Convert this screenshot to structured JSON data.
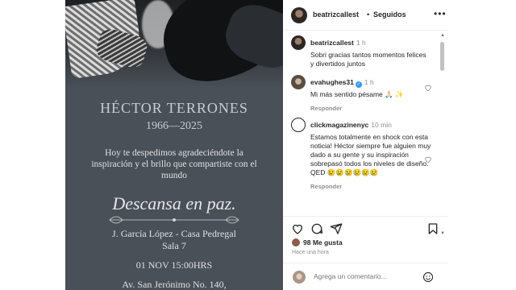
{
  "post_image": {
    "name": "HÉCTOR TERRONES",
    "years": "1966—2025",
    "message": "Hoy te despedimos agradeciéndote la inspiración y el brillo que compartiste con el mundo",
    "rest": "Descansa en paz.",
    "place": "J. García López - Casa Pedregal Sala 7",
    "datetime": "01 NOV 15:00HRS",
    "address": "Av. San Jerónimo No. 140,"
  },
  "header": {
    "username": "beatrizcallest",
    "separator": "•",
    "follow_status": "Seguidos",
    "more_icon": "more-horizontal-icon"
  },
  "comments": [
    {
      "user": "beatrizcallest",
      "time": "1 h",
      "text": "Sobri gracias tantos momentos felices y divertidos juntos",
      "reply": "",
      "avatar": "avatar-beatriz"
    },
    {
      "user": "evahughes31",
      "time": "1 h",
      "verified": true,
      "text": "Mi más sentido pésame 🙏🏻 ✨",
      "reply": "Responder",
      "avatar": "avatar-eva"
    },
    {
      "user": "clickmagazinenyc",
      "time": "10 min",
      "text": "Estamos totalmente en shock con esta noticia! Héctor siempre fue alguien muy dado a su gente y su inspiración sobrepasó todos los niveles de diseño. QED 😢😢😢😢😢😢",
      "reply": "Responder",
      "avatar": "avatar-click"
    }
  ],
  "actions": {
    "like_icon": "heart-icon",
    "comment_icon": "comment-icon",
    "share_icon": "send-icon",
    "save_icon": "bookmark-icon"
  },
  "likes": {
    "count": "98",
    "label": "Me gusta"
  },
  "post_time": "Hace una hora",
  "composer": {
    "placeholder": "Agrega un comentario...",
    "emoji_icon": "emoji-icon"
  },
  "colors": {
    "accent": "#3897f0",
    "text": "#262626",
    "muted": "#8e8e8e",
    "image_bg": "#4a5058"
  }
}
